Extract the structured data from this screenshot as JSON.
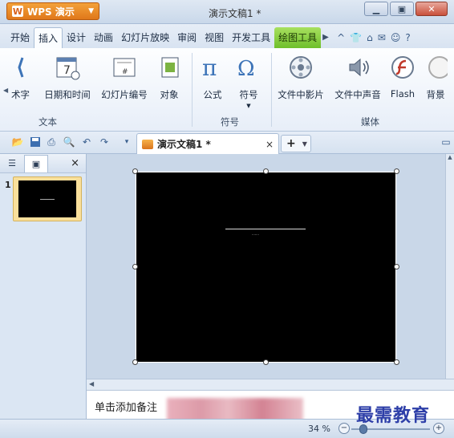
{
  "app": {
    "brand": "WPS 演示",
    "logo_char": "W",
    "doc_title": "演示文稿1 *"
  },
  "tabs": [
    "开始",
    "插入",
    "设计",
    "动画",
    "幻灯片放映",
    "审阅",
    "视图",
    "开发工具",
    "绘图工具"
  ],
  "active_tab": "插入",
  "ribbon": {
    "items": [
      {
        "label": "术字",
        "icon": "wordart-icon"
      },
      {
        "label": "日期和时间",
        "icon": "calendar-icon"
      },
      {
        "label": "幻灯片编号",
        "icon": "slide-number-icon"
      },
      {
        "label": "对象",
        "icon": "object-icon"
      },
      {
        "label": "公式",
        "icon": "pi-icon"
      },
      {
        "label": "符号",
        "icon": "omega-icon"
      },
      {
        "label": "文件中影片",
        "icon": "movie-icon"
      },
      {
        "label": "文件中声音",
        "icon": "speaker-icon"
      },
      {
        "label": "Flash",
        "icon": "flash-icon"
      },
      {
        "label": "背景",
        "icon": "background-icon"
      }
    ],
    "groups": [
      "文本",
      "符号",
      "媒体"
    ]
  },
  "doc_tab": {
    "label": "演示文稿1 *",
    "close": "×",
    "add": "+"
  },
  "left_panel": {
    "close": "×",
    "slide_number": "1"
  },
  "notes": {
    "placeholder": "单击添加备注"
  },
  "status": {
    "zoom": "34 %",
    "zoom_fraction": 0.15
  },
  "watermark": "最需教育"
}
